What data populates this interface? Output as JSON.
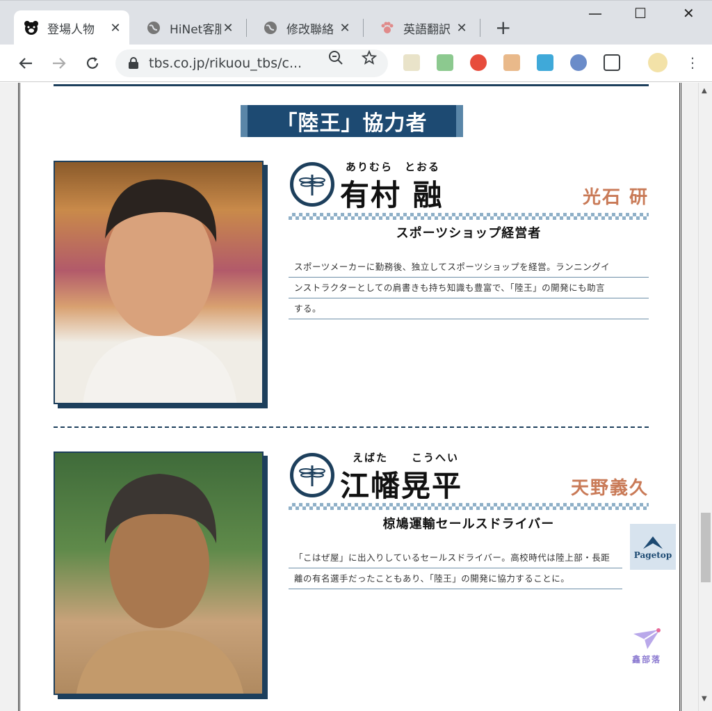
{
  "browser": {
    "tabs": [
      {
        "title": "登場人物",
        "close": "✕",
        "active": true
      },
      {
        "title": "HiNet客服",
        "close": "✕",
        "active": false
      },
      {
        "title": "修改聯絡",
        "close": "✕",
        "active": false
      },
      {
        "title": "英語翻訳",
        "close": "✕",
        "active": false
      }
    ],
    "new_tab": "+",
    "window_controls": {
      "minimize": "—",
      "maximize": "☐",
      "close": "✕"
    },
    "url": "tbs.co.jp/rikuou_tbs/c...",
    "menu": "⋮"
  },
  "page": {
    "section_title": "「陸王」協力者",
    "characters": [
      {
        "ruby": "ありむら　とおる",
        "name": "有村 融",
        "actor": "光石 研",
        "role": "スポーツショップ経営者",
        "description_lines": [
          "スポーツメーカーに勤務後、独立してスポーツショップを経営。ランニングイ",
          "ンストラクターとしての肩書きも持ち知識も豊富で、「陸王」の開発にも助言",
          "する。"
        ]
      },
      {
        "ruby": "えばた　　こうへい",
        "name": "江幡晃平",
        "actor": "天野義久",
        "role": "椋鳩運輸セールスドライバー",
        "description_lines": [
          "「こはぜ屋」に出入りしているセールスドライバー。高校時代は陸上部・長距",
          "離の有名選手だったこともあり、「陸王」の開発に協力することに。"
        ]
      }
    ],
    "pagetop_label": "Pagetop",
    "watermark_text": "鑫部落"
  },
  "colors": {
    "navy": "#1d3f5c",
    "actor_orange": "#c97a57",
    "banner_blue": "#1d4a72"
  }
}
